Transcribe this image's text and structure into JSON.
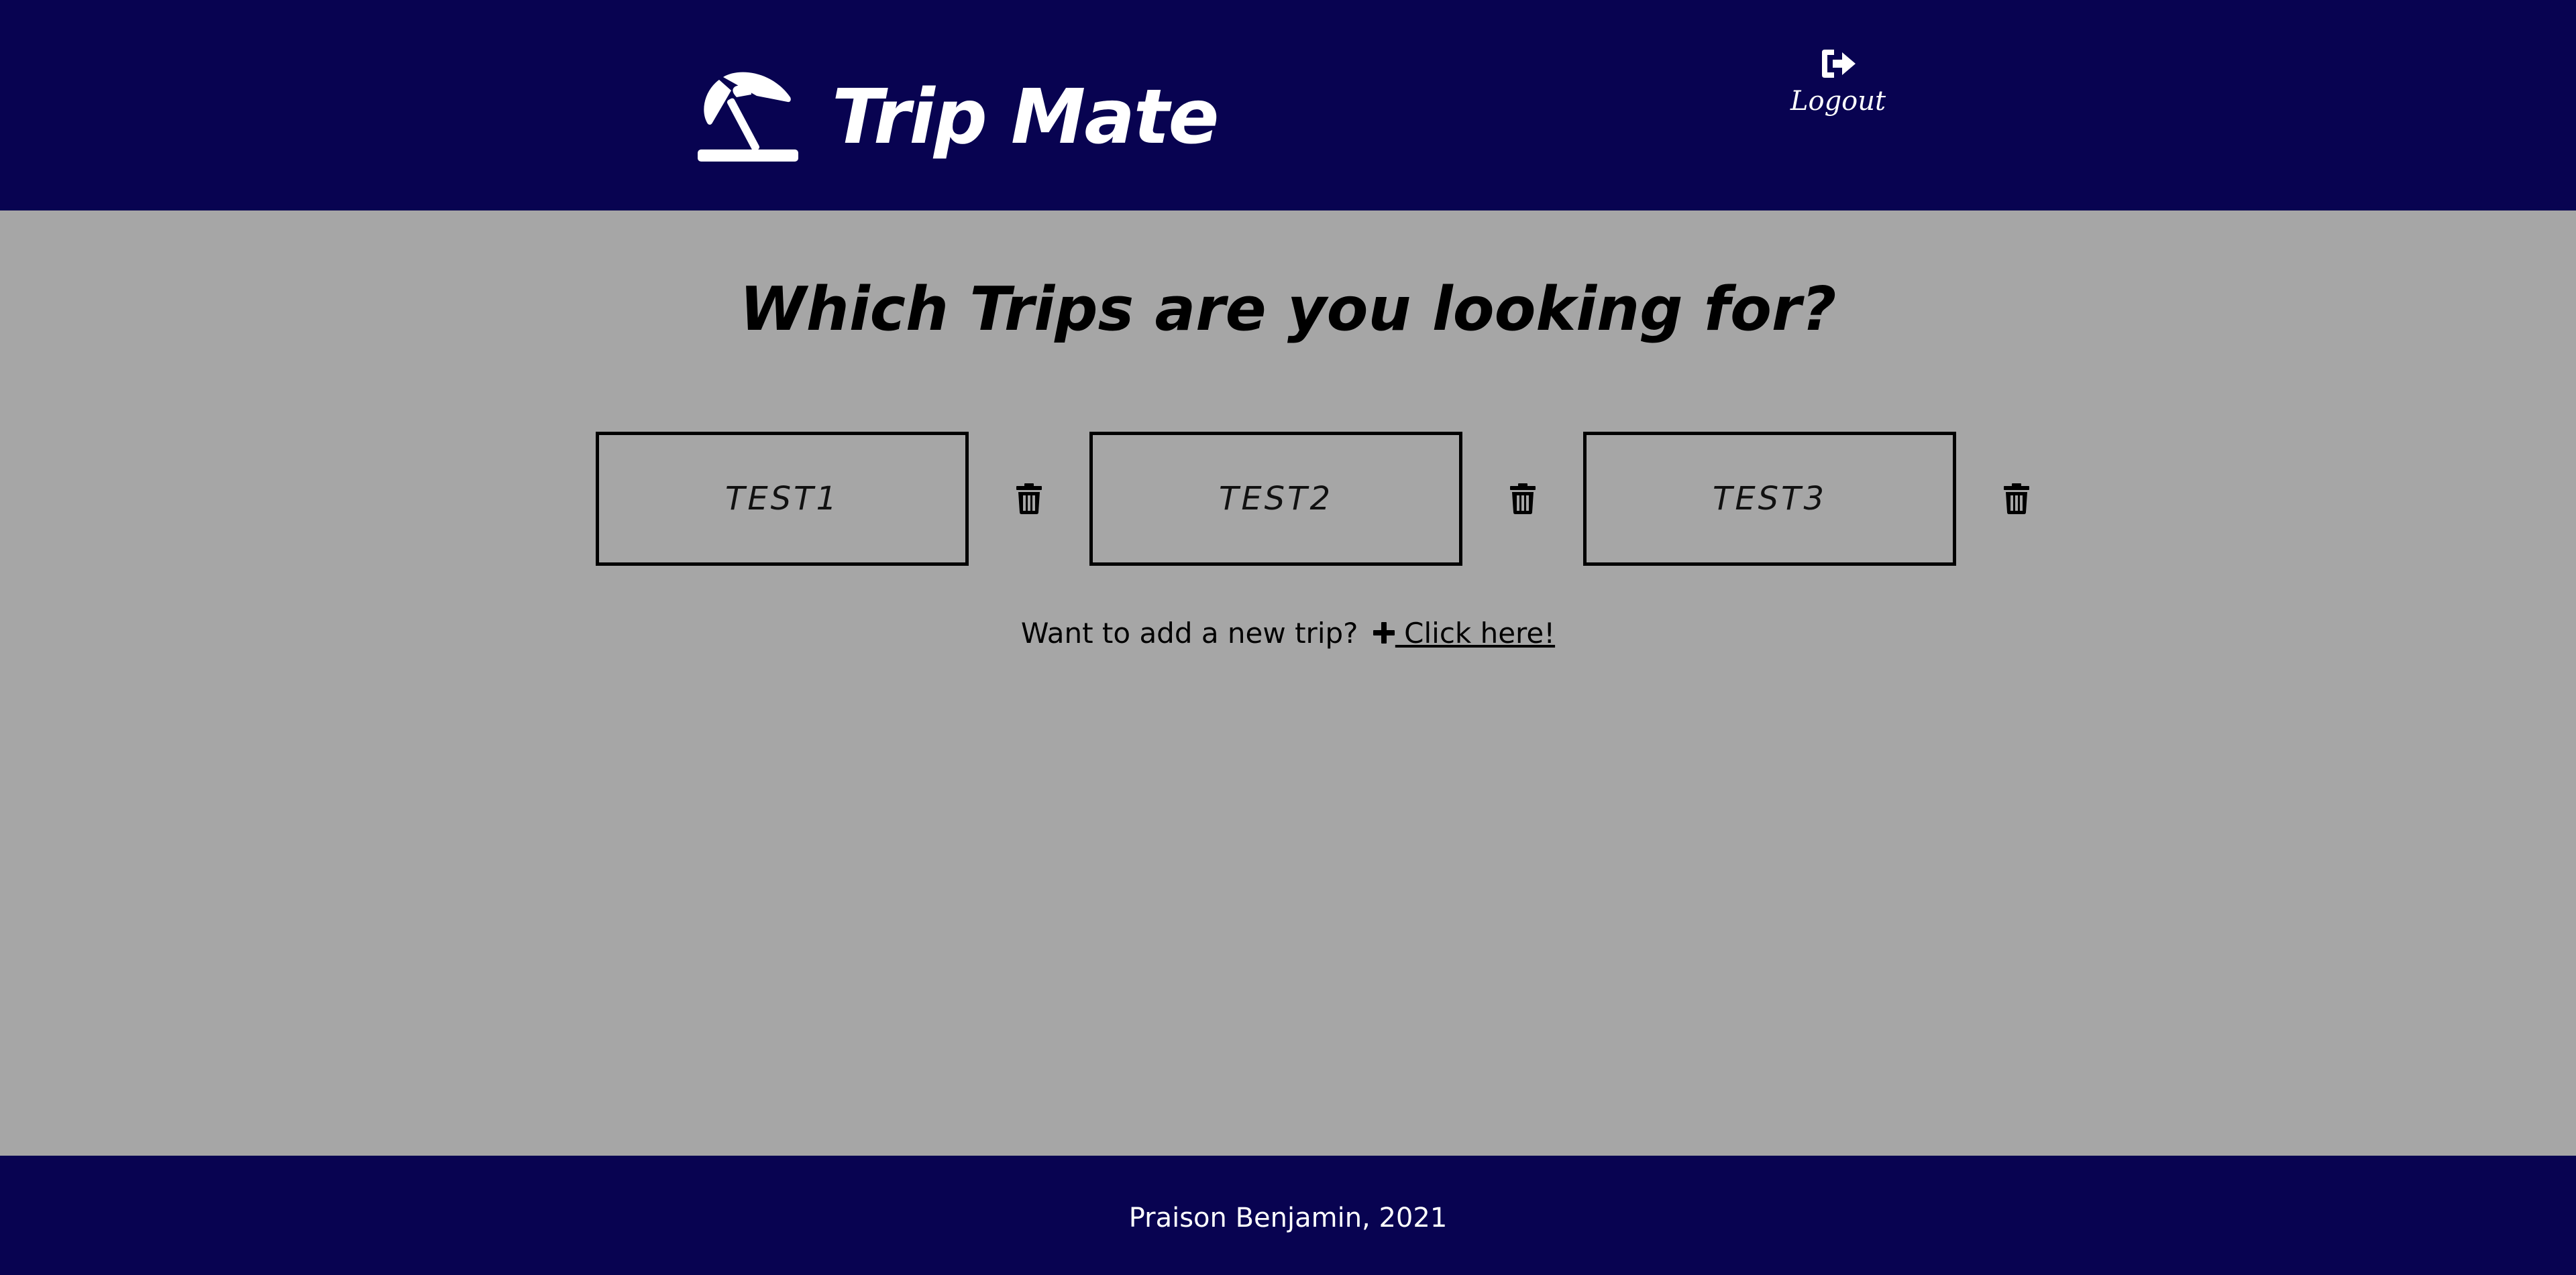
{
  "header": {
    "brand_title": "Trip Mate",
    "brand_icon": "beach-umbrella-icon",
    "logout_label": "Logout",
    "logout_icon": "sign-out-icon"
  },
  "main": {
    "title": "Which Trips are you looking for?",
    "trips": [
      {
        "name": "TEST1",
        "delete_icon": "trash-icon"
      },
      {
        "name": "TEST2",
        "delete_icon": "trash-icon"
      },
      {
        "name": "TEST3",
        "delete_icon": "trash-icon"
      }
    ],
    "add_prompt": "Want to add a new trip?",
    "add_icon": "plus-icon",
    "add_link": " Click here!"
  },
  "footer": {
    "text": "Praison Benjamin, 2021"
  },
  "colors": {
    "header_bg": "#080351",
    "page_bg": "#a6a6a6",
    "text": "#000000",
    "header_text": "#ffffff"
  }
}
